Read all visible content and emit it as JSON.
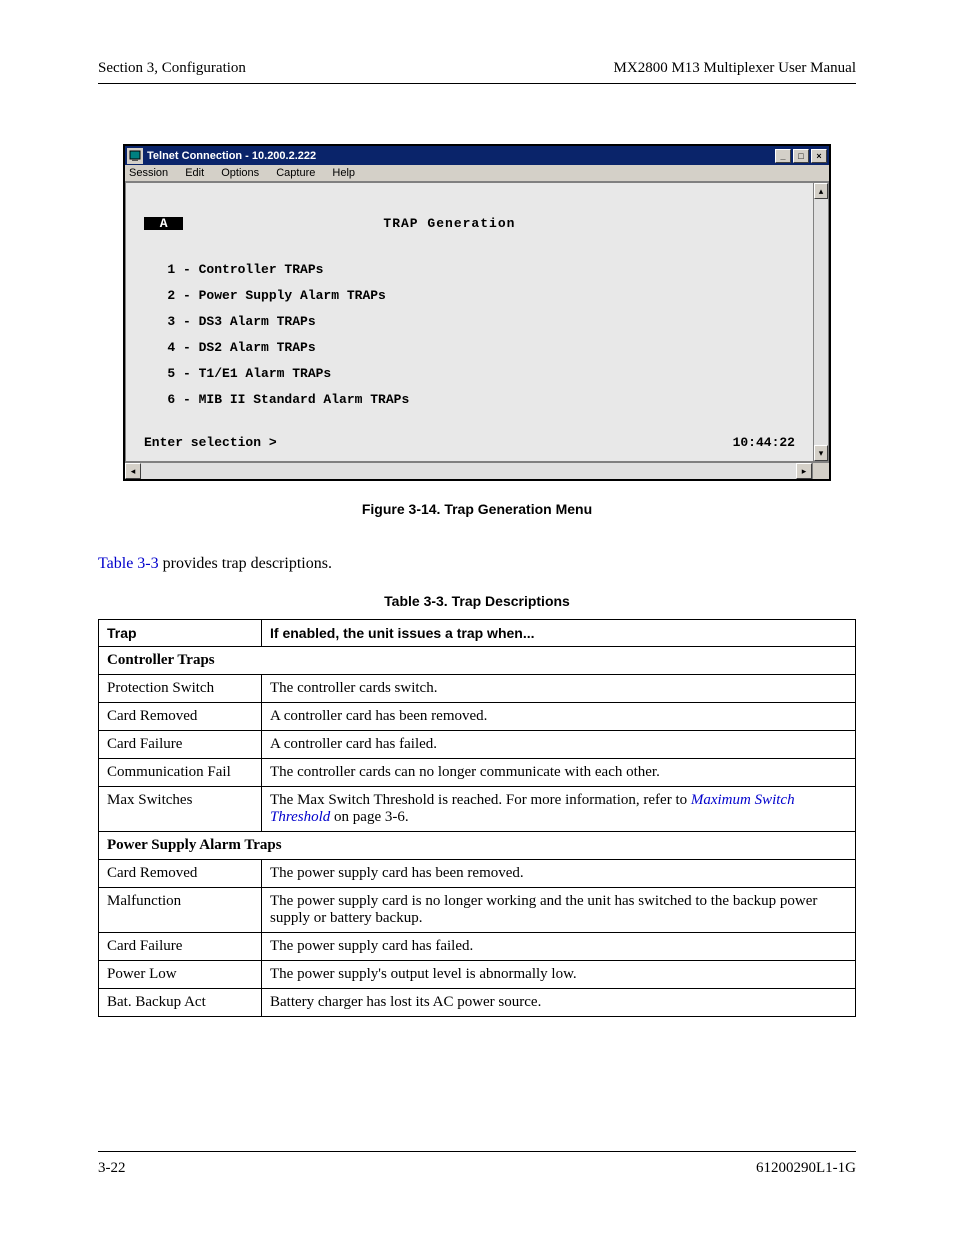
{
  "header": {
    "left": "Section 3, Configuration",
    "right": "MX2800 M13 Multiplexer User Manual"
  },
  "telnet": {
    "title": "Telnet Connection - 10.200.2.222",
    "menus": [
      "Session",
      "Edit",
      "Options",
      "Capture",
      "Help"
    ],
    "badge": " A ",
    "screen_title": "TRAP Generation",
    "items": [
      "1 - Controller TRAPs",
      "2 - Power Supply Alarm TRAPs",
      "3 - DS3 Alarm TRAPs",
      "4 - DS2 Alarm TRAPs",
      "5 - T1/E1 Alarm TRAPs",
      "6 - MIB II Standard Alarm TRAPs"
    ],
    "prompt": "Enter selection >",
    "clock": "10:44:22"
  },
  "figure_caption": "Figure 3-14.  Trap Generation Menu",
  "body_link": "Table 3-3",
  "body_rest": " provides trap descriptions.",
  "table_caption": "Table 3-3.  Trap Descriptions",
  "table": {
    "head": {
      "c1": "Trap",
      "c2": "If enabled, the unit issues a trap when..."
    },
    "section1": "Controller Traps",
    "rows1": [
      {
        "c1": "Protection Switch",
        "c2": "The controller cards switch."
      },
      {
        "c1": "Card Removed",
        "c2": "A controller card has been removed."
      },
      {
        "c1": "Card Failure",
        "c2": "A controller card has failed."
      },
      {
        "c1": "Communication Fail",
        "c2": "The controller cards can no longer communicate with each other."
      }
    ],
    "max_switches": {
      "c1": "Max Switches",
      "pre": "The Max Switch Threshold is reached. For more information, refer to ",
      "link": "Maximum Switch Threshold",
      "post": " on page 3-6."
    },
    "section2": "Power Supply Alarm Traps",
    "rows2": [
      {
        "c1": "Card Removed",
        "c2": "The power supply card has been removed."
      },
      {
        "c1": "Malfunction",
        "c2": "The power supply card is no longer working and the unit has switched to the backup power supply or battery backup."
      },
      {
        "c1": "Card Failure",
        "c2": "The power supply card has failed."
      },
      {
        "c1": "Power Low",
        "c2": "The power supply's output level is abnormally low."
      },
      {
        "c1": "Bat. Backup Act",
        "c2": "Battery charger has lost its AC power source."
      }
    ]
  },
  "footer": {
    "left": "3-22",
    "right": "61200290L1-1G"
  }
}
